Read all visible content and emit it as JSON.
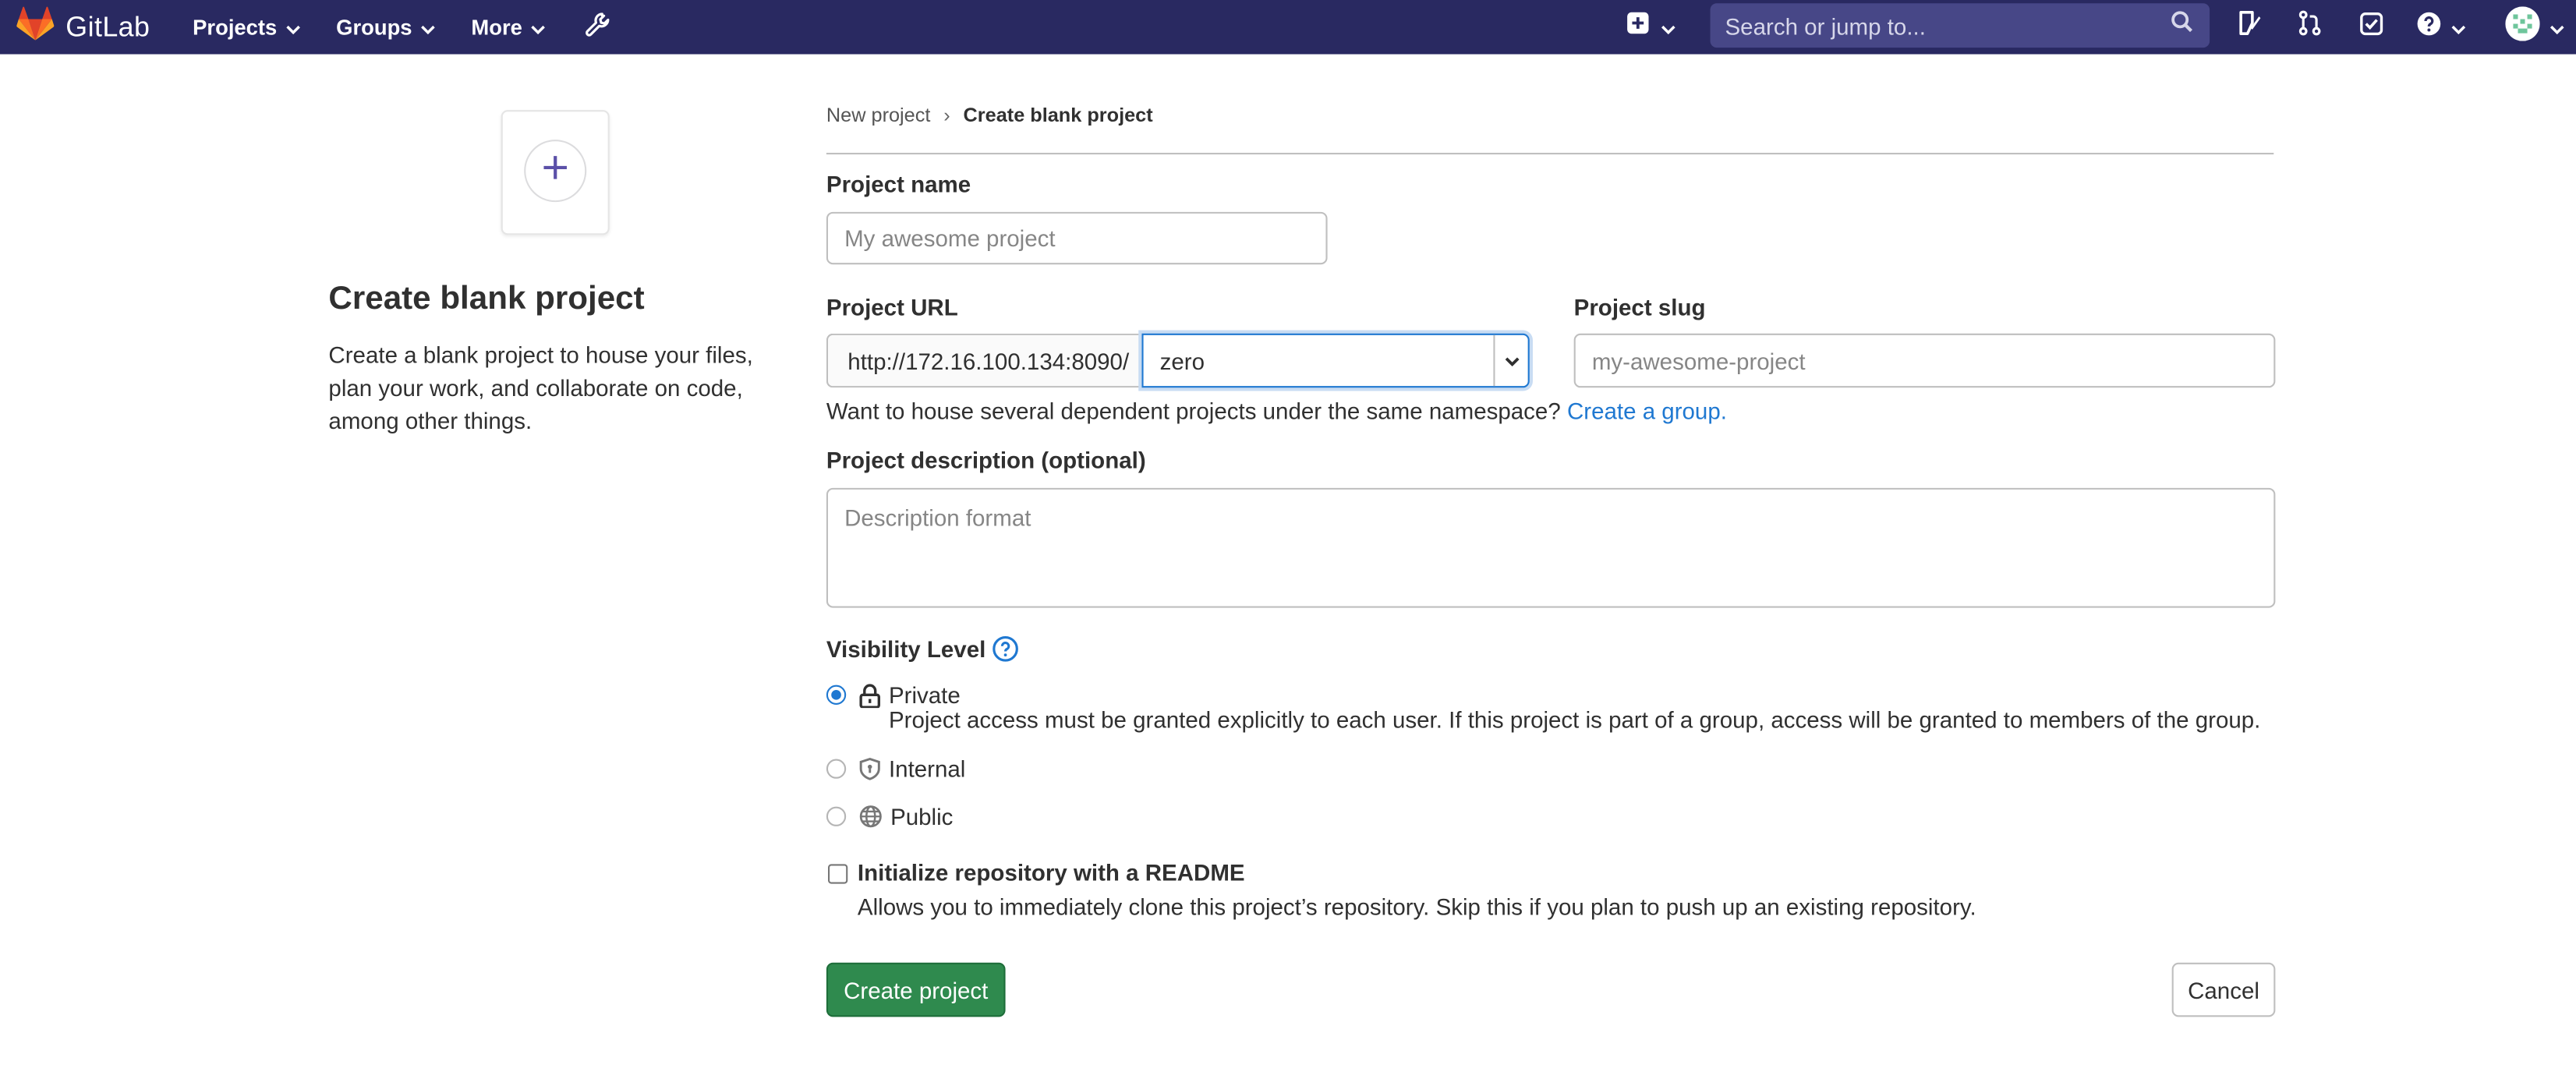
{
  "navbar": {
    "brand": "GitLab",
    "menu": [
      {
        "label": "Projects"
      },
      {
        "label": "Groups"
      },
      {
        "label": "More"
      }
    ],
    "search_placeholder": "Search or jump to..."
  },
  "left_panel": {
    "title": "Create blank project",
    "description": "Create a blank project to house your files, plan your work, and collaborate on code, among other things."
  },
  "breadcrumb": {
    "parent": "New project",
    "separator": "›",
    "current": "Create blank project"
  },
  "form": {
    "project_name": {
      "label": "Project name",
      "placeholder": "My awesome project",
      "value": ""
    },
    "project_url": {
      "label": "Project URL",
      "prefix": "http://172.16.100.134:8090/",
      "namespace": "zero"
    },
    "project_slug": {
      "label": "Project slug",
      "placeholder": "my-awesome-project",
      "value": ""
    },
    "namespace_help": {
      "text": "Want to house several dependent projects under the same namespace?",
      "link": "Create a group."
    },
    "description": {
      "label": "Project description (optional)",
      "placeholder": "Description format",
      "value": ""
    },
    "visibility": {
      "label": "Visibility Level",
      "options": [
        {
          "label": "Private",
          "checked": true,
          "icon": "lock-icon",
          "description": "Project access must be granted explicitly to each user. If this project is part of a group, access will be granted to members of the group."
        },
        {
          "label": "Internal",
          "checked": false,
          "icon": "shield-icon"
        },
        {
          "label": "Public",
          "checked": false,
          "icon": "globe-icon"
        }
      ]
    },
    "readme": {
      "label": "Initialize repository with a README",
      "description": "Allows you to immediately clone this project’s repository. Skip this if you plan to push up an existing repository.",
      "checked": false
    },
    "submit_label": "Create project",
    "cancel_label": "Cancel"
  },
  "colors": {
    "navbar": "#292961",
    "search": "#474787",
    "primary_button": "#2f8a4e",
    "link": "#1f78d1"
  }
}
